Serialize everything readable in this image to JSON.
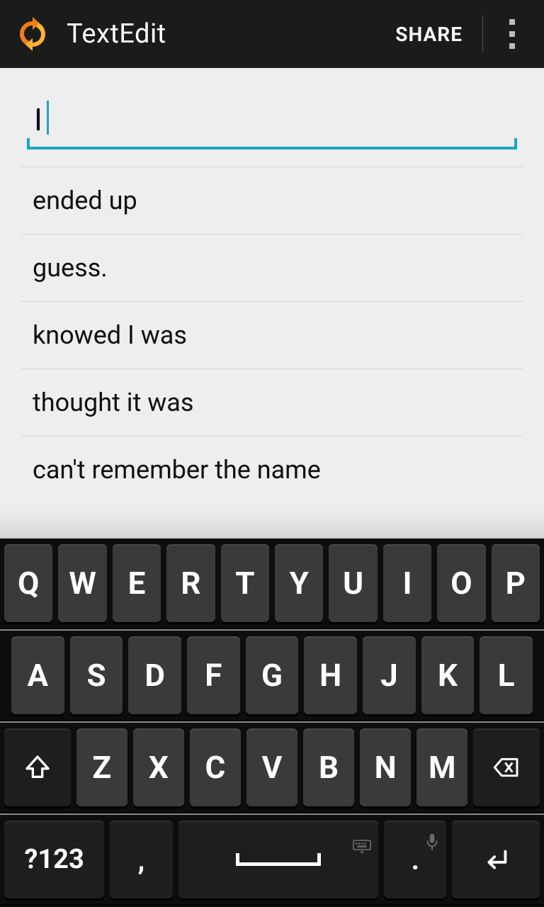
{
  "header": {
    "title": "TextEdit",
    "share_label": "SHARE"
  },
  "editor": {
    "text": "I"
  },
  "suggestions": [
    "ended up",
    "guess.",
    "knowed I was",
    "thought it was",
    "can't remember the name"
  ],
  "keyboard": {
    "row1": [
      "Q",
      "W",
      "E",
      "R",
      "T",
      "Y",
      "U",
      "I",
      "O",
      "P"
    ],
    "row2": [
      "A",
      "S",
      "D",
      "F",
      "G",
      "H",
      "J",
      "K",
      "L"
    ],
    "row3": [
      "Z",
      "X",
      "C",
      "V",
      "B",
      "N",
      "M"
    ],
    "sym_label": "?123",
    "comma": ",",
    "period": "."
  }
}
